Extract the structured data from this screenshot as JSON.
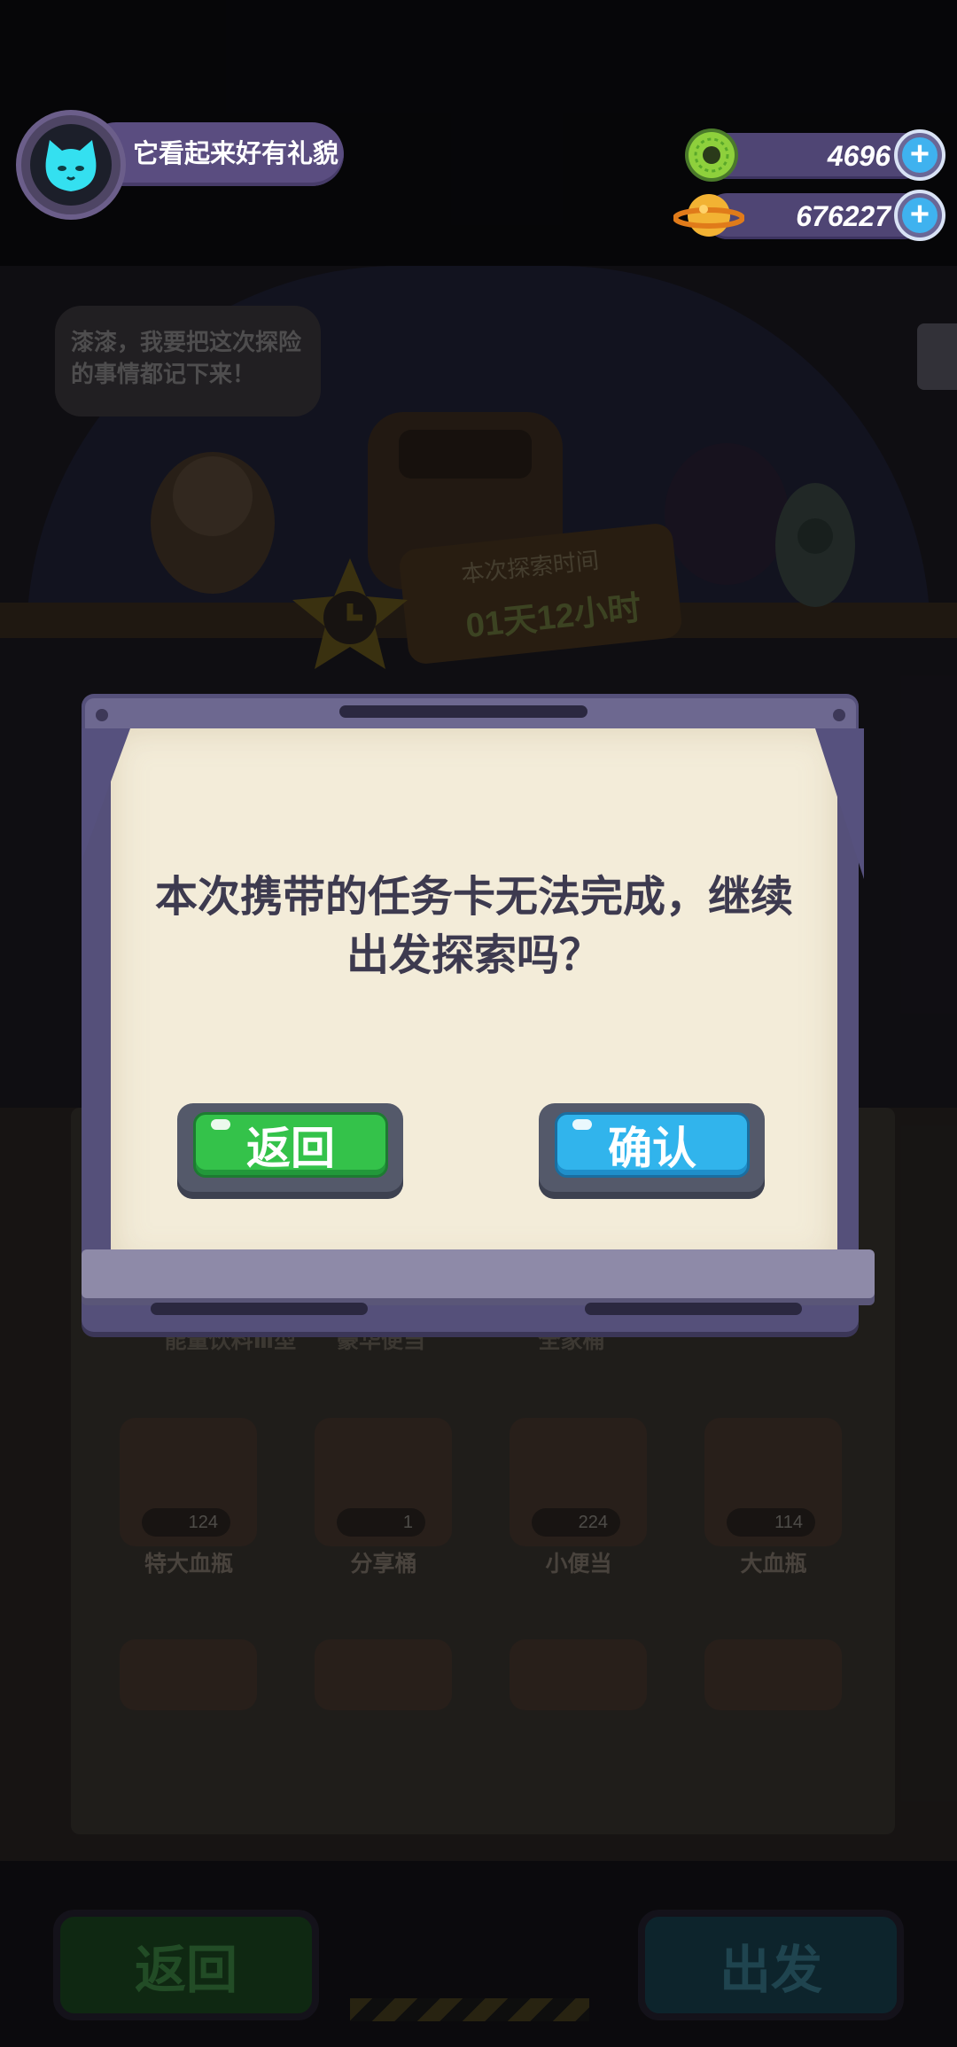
{
  "hud": {
    "pet_status": "它看起来好有礼貌",
    "gems": "4696",
    "coins": "676227"
  },
  "scene": {
    "bubble_text": "漆漆，我要把这次探险的事情都记下来！",
    "timer_label": "本次探索时间",
    "timer_value": "01天12小时",
    "items_row_top": [
      "能量饮料Ⅲ型",
      "豪华便当",
      "全家桶",
      ""
    ],
    "items": [
      {
        "label": "特大血瓶",
        "count": "124"
      },
      {
        "label": "分享桶",
        "count": "1"
      },
      {
        "label": "小便当",
        "count": "224"
      },
      {
        "label": "大血瓶",
        "count": "114"
      }
    ],
    "bottom_back": "返回",
    "bottom_go": "出发"
  },
  "dialog": {
    "message": "本次携带的任务卡无法完成，继续出发探索吗？",
    "back_label": "返回",
    "confirm_label": "确认"
  },
  "colors": {
    "back_green": "#34c24a",
    "confirm_blue": "#31b4ec",
    "paper": "#f3ecd9",
    "frame": "#55507a"
  }
}
